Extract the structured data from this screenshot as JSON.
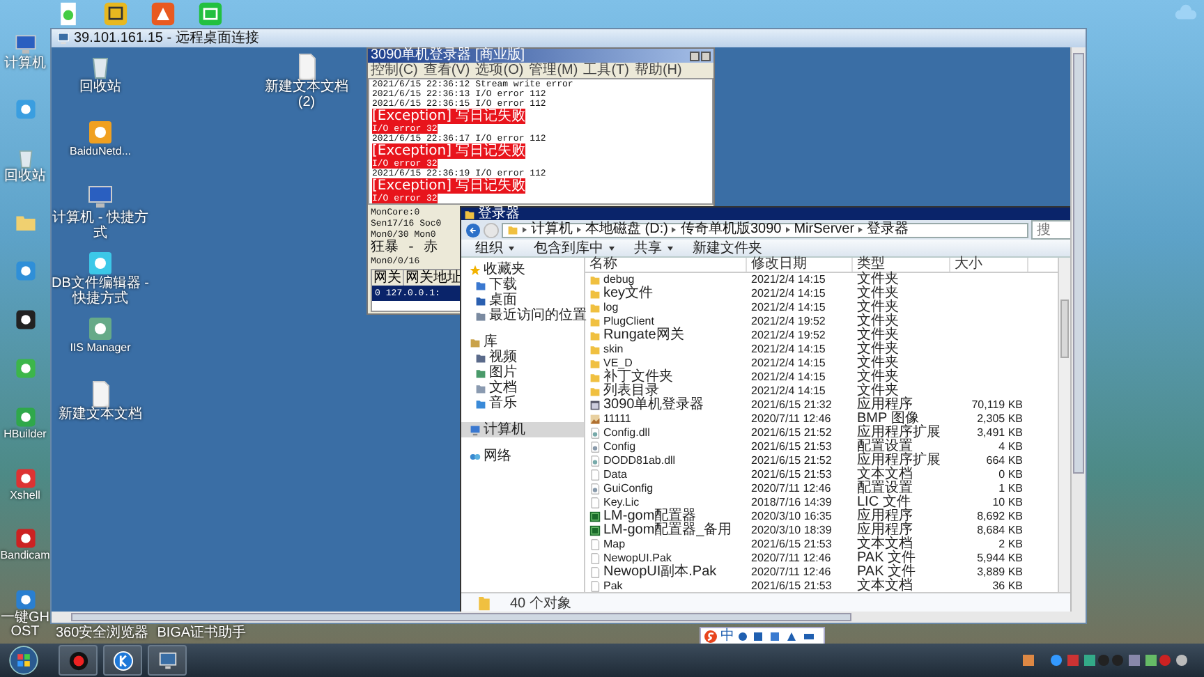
{
  "host_desktop": {
    "icons": [
      {
        "kind": "computer",
        "label": "计算机"
      },
      {
        "kind": "cloud"
      },
      {
        "kind": "recycle",
        "label": "回收站"
      },
      {
        "kind": "folder"
      },
      {
        "kind": "globe"
      },
      {
        "kind": "penguin"
      },
      {
        "kind": "chat"
      },
      {
        "kind": "hbuilder",
        "label": "HBuilder"
      },
      {
        "kind": "xshell",
        "label": "Xshell"
      },
      {
        "kind": "record",
        "label": "Bandicam"
      },
      {
        "kind": "ghost",
        "label": "一键GHOST"
      }
    ],
    "bottom_labels": [
      "360安全浏览器",
      "BIGA证书助手"
    ]
  },
  "remote_window": {
    "title": "39.101.161.15 - 远程桌面连接",
    "icons": [
      {
        "kind": "recycle",
        "label": "回收站"
      },
      {
        "kind": "baidu",
        "label": "BaiduNetd..."
      },
      {
        "kind": "computer",
        "label": "计算机 - 快捷方式"
      },
      {
        "kind": "db",
        "label": "DB文件编辑器 - 快捷方式"
      },
      {
        "kind": "server",
        "label": "IIS Manager"
      },
      {
        "kind": "text",
        "label": "新建文本文档"
      },
      {
        "kind": "text",
        "label": "新建文本文档 (2)"
      }
    ],
    "log_window": {
      "title": "3090单机登录器 [商业版]",
      "menu": [
        "控制(C)",
        "查看(V)",
        "选项(O)",
        "管理(M)",
        "工具(T)",
        "帮助(H)"
      ],
      "lines": [
        {
          "text": "2021/6/15 22:36:12 Stream write error",
          "error": false
        },
        {
          "text": "2021/6/15 22:36:13 I/O error 112",
          "error": false
        },
        {
          "text": "2021/6/15 22:36:15 I/O error 112",
          "error": false
        },
        {
          "text": "[Exception] 写日记失败",
          "error": true
        },
        {
          "text": "I/O error 32",
          "error": true
        },
        {
          "text": "2021/6/15 22:36:17 I/O error 112",
          "error": false
        },
        {
          "text": "[Exception] 写日记失败",
          "error": true
        },
        {
          "text": "I/O error 32",
          "error": true
        },
        {
          "text": "2021/6/15 22:36:19 I/O error 112",
          "error": false
        },
        {
          "text": "[Exception] 写日记失败",
          "error": true
        },
        {
          "text": "I/O error 32",
          "error": true
        }
      ],
      "status_lines": [
        "MonCore:0",
        "Sen17/16 Soc0",
        "Mon0/30 Mon0",
        "狂暴 - 赤",
        "Mon0/0/16"
      ],
      "table": {
        "columns": [
          "网关",
          "网关地址"
        ],
        "rows": [
          {
            "cells": [
              "0",
              "127.0.0.1:"
            ],
            "selected": true
          }
        ]
      }
    },
    "explorer": {
      "title": "登录器",
      "path": [
        "计算机",
        "本地磁盘 (D:)",
        "传奇单机版3090",
        "MirServer",
        "登录器"
      ],
      "search": {
        "placeholder": "搜"
      },
      "toolbar": [
        {
          "label": "组织",
          "dropdown": true
        },
        {
          "label": "包含到库中",
          "dropdown": true
        },
        {
          "label": "共享",
          "dropdown": true
        },
        {
          "label": "新建文件夹",
          "dropdown": false
        }
      ],
      "nav": [
        {
          "label": "收藏夹",
          "kind": "star",
          "selected": false,
          "children": [
            {
              "label": "下载",
              "kind": "download",
              "selected": false
            },
            {
              "label": "桌面",
              "kind": "desktop",
              "selected": false
            },
            {
              "label": "最近访问的位置",
              "kind": "recent",
              "selected": false
            }
          ]
        },
        {
          "label": "库",
          "kind": "library",
          "selected": false,
          "children": [
            {
              "label": "视频",
              "kind": "video",
              "selected": false
            },
            {
              "label": "图片",
              "kind": "picture",
              "selected": false
            },
            {
              "label": "文档",
              "kind": "document",
              "selected": false
            },
            {
              "label": "音乐",
              "kind": "music",
              "selected": false
            }
          ]
        },
        {
          "label": "计算机",
          "kind": "computer",
          "selected": true
        },
        {
          "label": "网络",
          "kind": "network",
          "selected": false
        }
      ],
      "columns": [
        "名称",
        "修改日期",
        "类型",
        "大小"
      ],
      "rows": [
        {
          "name": "debug",
          "date": "2021/2/4 14:15",
          "type": "文件夹",
          "kind": "folder"
        },
        {
          "name": "key文件",
          "date": "2021/2/4 14:15",
          "type": "文件夹",
          "kind": "folder"
        },
        {
          "name": "log",
          "date": "2021/2/4 14:15",
          "type": "文件夹",
          "kind": "folder"
        },
        {
          "name": "PlugClient",
          "date": "2021/2/4 19:52",
          "type": "文件夹",
          "kind": "folder"
        },
        {
          "name": "Rungate网关",
          "date": "2021/2/4 19:52",
          "type": "文件夹",
          "kind": "folder"
        },
        {
          "name": "skin",
          "date": "2021/2/4 14:15",
          "type": "文件夹",
          "kind": "folder"
        },
        {
          "name": "VE_D",
          "date": "2021/2/4 14:15",
          "type": "文件夹",
          "kind": "folder"
        },
        {
          "name": "补丁文件夹",
          "date": "2021/2/4 14:15",
          "type": "文件夹",
          "kind": "folder"
        },
        {
          "name": "列表目录",
          "date": "2021/2/4 14:15",
          "type": "文件夹",
          "kind": "folder"
        },
        {
          "name": "3090单机登录器",
          "date": "2021/6/15 21:32",
          "type": "应用程序",
          "size": "70,119 KB",
          "kind": "app"
        },
        {
          "name": "11111",
          "date": "2020/7/11 12:46",
          "type": "BMP 图像",
          "size": "2,305 KB",
          "kind": "image"
        },
        {
          "name": "Config.dll",
          "date": "2021/6/15 21:52",
          "type": "应用程序扩展",
          "size": "3,491 KB",
          "kind": "dll"
        },
        {
          "name": "Config",
          "date": "2021/6/15 21:53",
          "type": "配置设置",
          "size": "4 KB",
          "kind": "config"
        },
        {
          "name": "DODD81ab.dll",
          "date": "2021/6/15 21:52",
          "type": "应用程序扩展",
          "size": "664 KB",
          "kind": "dll"
        },
        {
          "name": "Data",
          "date": "2021/6/15 21:53",
          "type": "文本文档",
          "size": "0 KB",
          "kind": "file"
        },
        {
          "name": "GuiConfig",
          "date": "2020/7/11 12:46",
          "type": "配置设置",
          "size": "1 KB",
          "kind": "config"
        },
        {
          "name": "Key.Lic",
          "date": "2018/7/16 14:39",
          "type": "LIC 文件",
          "size": "10 KB",
          "kind": "file"
        },
        {
          "name": "LM-gom配置器",
          "date": "2020/3/10 16:35",
          "type": "应用程序",
          "size": "8,692 KB",
          "kind": "green-app"
        },
        {
          "name": "LM-gom配置器_备用",
          "date": "2020/3/10 18:39",
          "type": "应用程序",
          "size": "8,684 KB",
          "kind": "green-app"
        },
        {
          "name": "Map",
          "date": "2021/6/15 21:53",
          "type": "文本文档",
          "size": "2 KB",
          "kind": "file"
        },
        {
          "name": "NewopUI.Pak",
          "date": "2020/7/11 12:46",
          "type": "PAK 文件",
          "size": "5,944 KB",
          "kind": "file"
        },
        {
          "name": "NewopUI副本.Pak",
          "date": "2020/7/11 12:46",
          "type": "PAK 文件",
          "size": "3,889 KB",
          "kind": "file"
        },
        {
          "name": "Pak",
          "date": "2021/6/15 21:53",
          "type": "文本文档",
          "size": "36 KB",
          "kind": "file"
        }
      ],
      "status": "40 个对象"
    }
  },
  "ime_bar": {
    "mode": "中"
  },
  "taskbar": {
    "apps": [
      {
        "kind": "record"
      },
      {
        "kind": "k"
      },
      {
        "kind": "remote"
      }
    ]
  }
}
